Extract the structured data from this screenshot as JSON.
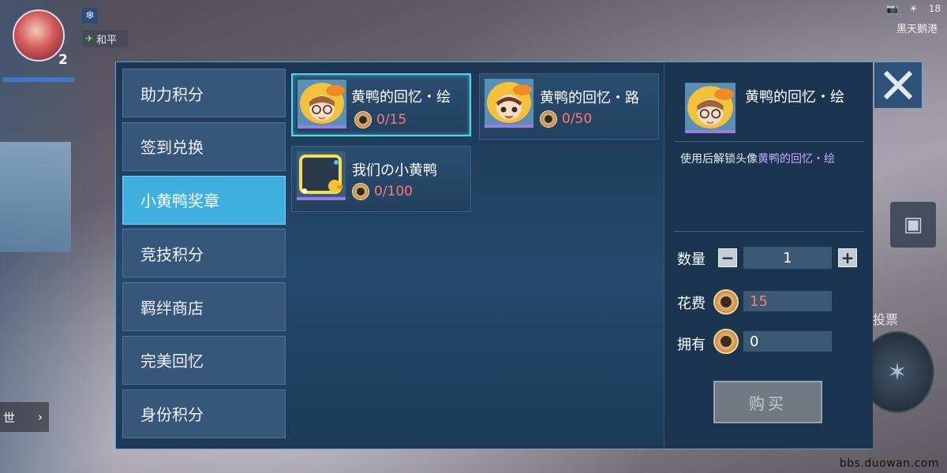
{
  "hud": {
    "level": "2",
    "mode_label": "和平",
    "battery": "18",
    "location": "黑天鹅港",
    "vote_label": "投票",
    "world_label": "世"
  },
  "tabs": [
    {
      "label": "助力积分",
      "active": false
    },
    {
      "label": "签到兑换",
      "active": false
    },
    {
      "label": "小黄鸭奖章",
      "active": true
    },
    {
      "label": "竞技积分",
      "active": false
    },
    {
      "label": "羁绊商店",
      "active": false
    },
    {
      "label": "完美回忆",
      "active": false
    },
    {
      "label": "身份积分",
      "active": false
    }
  ],
  "items": [
    {
      "name": "黄鸭的回忆・绘",
      "cost": "0/15",
      "selected": true
    },
    {
      "name": "黄鸭的回忆・路",
      "cost": "0/50",
      "selected": false
    },
    {
      "name": "我们の小黄鸭",
      "cost": "0/100",
      "selected": false
    }
  ],
  "detail": {
    "name": "黄鸭的回忆・绘",
    "desc_prefix": "使用后解锁头像",
    "desc_highlight": "黄鸭的回忆・绘",
    "quantity_label": "数量",
    "quantity": "1",
    "minus": "−",
    "plus": "+",
    "cost_label": "花费",
    "cost_value": "15",
    "own_label": "拥有",
    "own_value": "0",
    "buy_label": "购买"
  },
  "colors": {
    "active_tab": "#3fb0df",
    "selected_border": "#4cd9ee",
    "cost_red": "#ff7777",
    "highlight_purple": "#c9a6ff"
  },
  "watermark": "bbs.duowan.com"
}
